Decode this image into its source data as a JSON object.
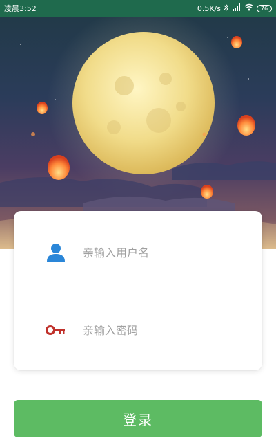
{
  "status_bar": {
    "time": "凌晨3:52",
    "network_speed": "0.5K/s",
    "battery": "76"
  },
  "login_form": {
    "username_placeholder": "亲输入用户名",
    "password_placeholder": "亲输入密码",
    "login_label": "登录"
  },
  "colors": {
    "status_bar": "#1f6a4d",
    "login_button": "#5dbb63",
    "user_icon": "#2a86d8",
    "key_icon": "#c0312b"
  },
  "icons": {
    "user": "person-icon",
    "password": "key-icon"
  }
}
